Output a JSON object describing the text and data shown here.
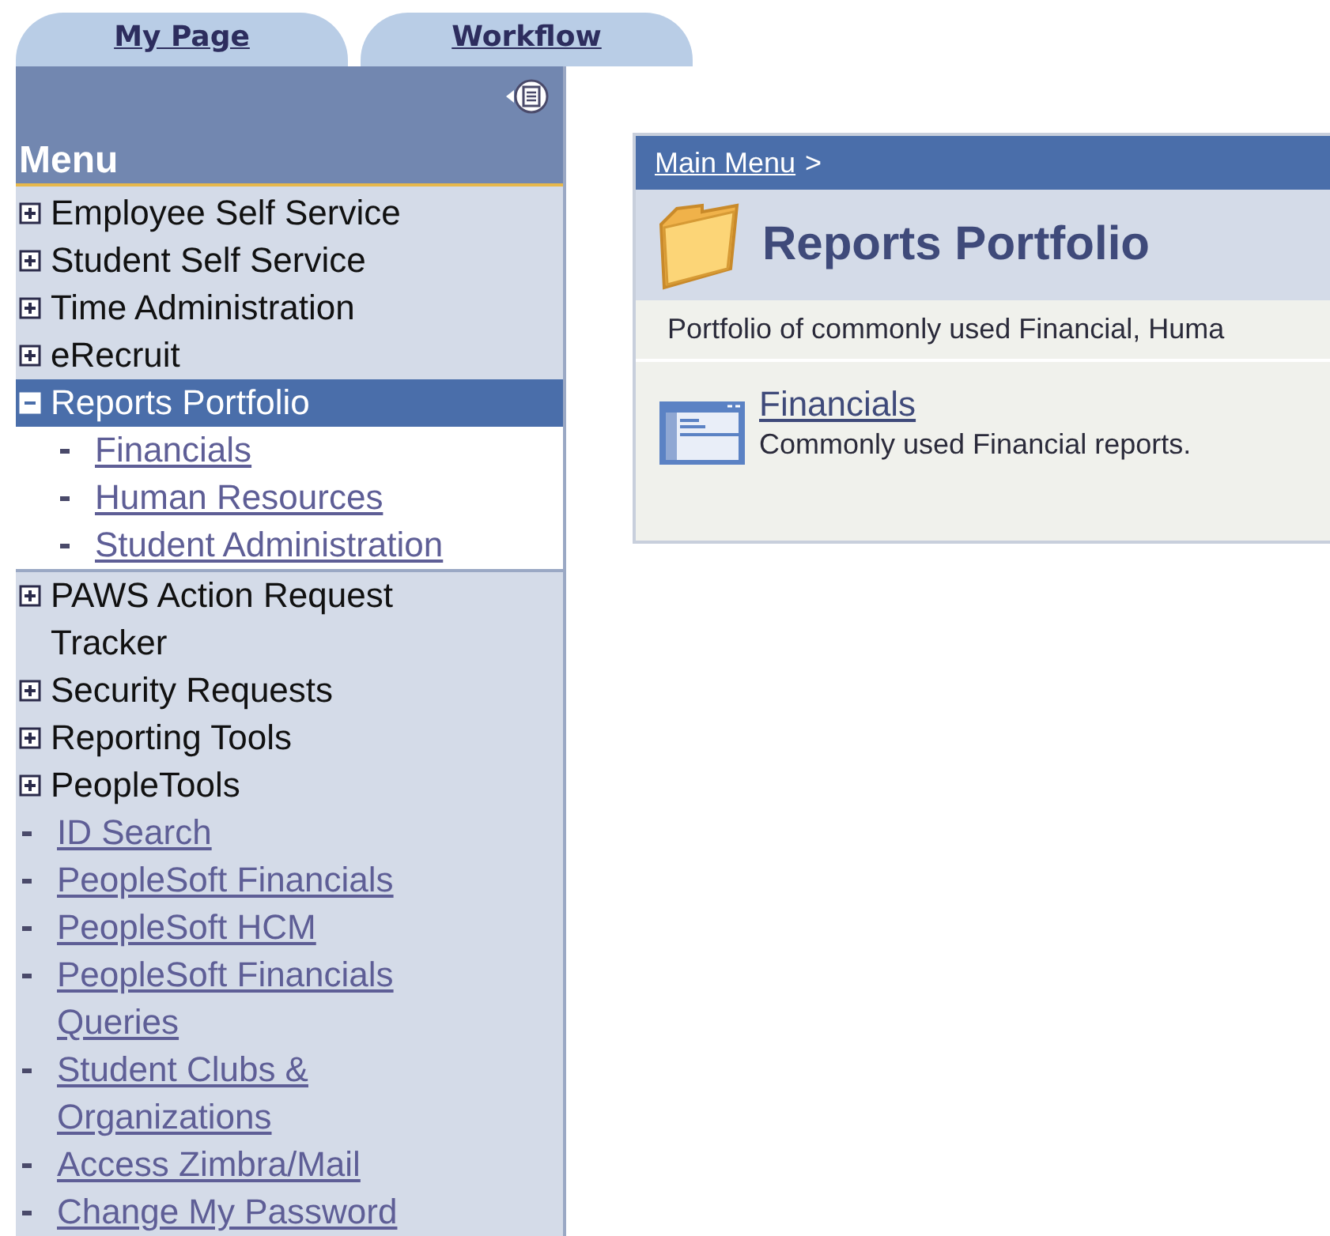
{
  "tabs": [
    {
      "label": "My Page",
      "selected": false
    },
    {
      "label": "Workflow",
      "selected": false
    }
  ],
  "sidebar": {
    "title": "Menu",
    "items": [
      {
        "label": "Employee Self Service",
        "kind": "folder",
        "expanded": false,
        "selected": false
      },
      {
        "label": "Student Self Service",
        "kind": "folder",
        "expanded": false,
        "selected": false
      },
      {
        "label": "Time Administration",
        "kind": "folder",
        "expanded": false,
        "selected": false
      },
      {
        "label": "eRecruit",
        "kind": "folder",
        "expanded": false,
        "selected": false
      },
      {
        "label": "Reports Portfolio",
        "kind": "folder",
        "expanded": true,
        "selected": true,
        "children": [
          {
            "label": "Financials",
            "kind": "link"
          },
          {
            "label": "Human Resources",
            "kind": "link"
          },
          {
            "label": "Student Administration",
            "kind": "link"
          }
        ]
      },
      {
        "label": "PAWS Action Request Tracker",
        "kind": "folder",
        "expanded": false,
        "selected": false
      },
      {
        "label": "Security Requests",
        "kind": "folder",
        "expanded": false,
        "selected": false
      },
      {
        "label": "Reporting Tools",
        "kind": "folder",
        "expanded": false,
        "selected": false
      },
      {
        "label": "PeopleTools",
        "kind": "folder",
        "expanded": false,
        "selected": false
      },
      {
        "label": "ID Search",
        "kind": "link"
      },
      {
        "label": "PeopleSoft Financials",
        "kind": "link"
      },
      {
        "label": "PeopleSoft HCM",
        "kind": "link"
      },
      {
        "label": "PeopleSoft Financials Queries",
        "kind": "link"
      },
      {
        "label": "Student Clubs & Organizations",
        "kind": "link"
      },
      {
        "label": "Access Zimbra/Mail",
        "kind": "link"
      },
      {
        "label": "Change My Password",
        "kind": "link"
      }
    ]
  },
  "content": {
    "breadcrumb": {
      "link": "Main Menu",
      "separator": ">"
    },
    "title": "Reports Portfolio",
    "description": "Portfolio of commonly used Financial, Huma",
    "entries": [
      {
        "title": "Financials",
        "description": "Commonly used Financial reports."
      }
    ]
  }
}
